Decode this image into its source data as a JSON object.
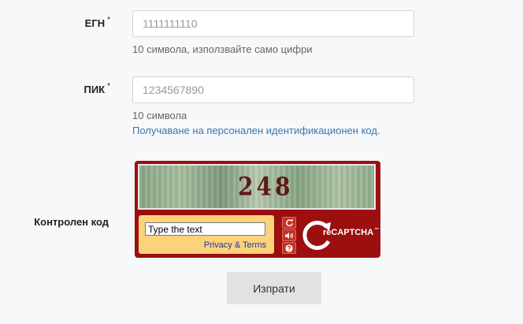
{
  "egn": {
    "label": "ЕГН",
    "required_mark": "*",
    "placeholder": "1111111110",
    "hint": "10 символа, използвайте само цифри"
  },
  "pik": {
    "label": "ПИК",
    "required_mark": "*",
    "placeholder": "1234567890",
    "hint": "10 символа",
    "link": "Получаване на персонален идентификационен код."
  },
  "captcha": {
    "label": "Контролен код",
    "challenge_text": "248",
    "input_placeholder": "Type the text",
    "privacy_link": "Privacy & Terms",
    "brand_text": "reCAPTCHA",
    "brand_tm": "™",
    "buttons": [
      "refresh-icon",
      "audio-icon",
      "help-icon"
    ],
    "colors": {
      "frame": "#9c0f0f",
      "input_panel": "#fcd37a",
      "button": "#c43226"
    }
  },
  "submit": {
    "label": "Изпрати"
  }
}
